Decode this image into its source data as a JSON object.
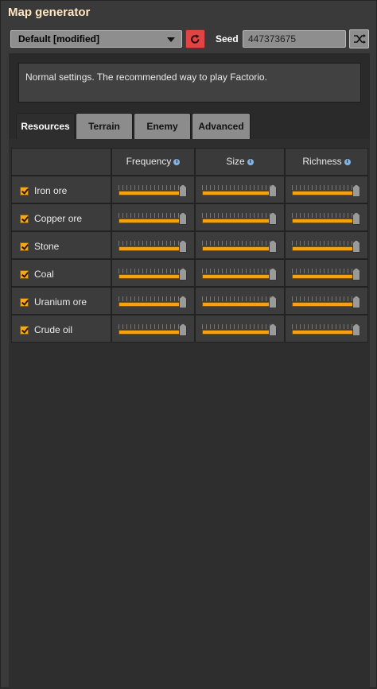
{
  "window": {
    "title": "Map generator"
  },
  "preset": {
    "value": "Default [modified]"
  },
  "seed": {
    "label": "Seed",
    "value": "447373675"
  },
  "description": "Normal settings. The recommended way to play Factorio.",
  "tabs": [
    {
      "label": "Resources",
      "active": true
    },
    {
      "label": "Terrain",
      "active": false
    },
    {
      "label": "Enemy",
      "active": false
    },
    {
      "label": "Advanced",
      "active": false
    }
  ],
  "columns": {
    "frequency": "Frequency",
    "size": "Size",
    "richness": "Richness"
  },
  "resources": [
    {
      "name": "Iron ore",
      "checked": true,
      "frequency": 1.0,
      "size": 1.0,
      "richness": 1.0
    },
    {
      "name": "Copper ore",
      "checked": true,
      "frequency": 1.0,
      "size": 1.0,
      "richness": 1.0
    },
    {
      "name": "Stone",
      "checked": true,
      "frequency": 1.0,
      "size": 1.0,
      "richness": 1.0
    },
    {
      "name": "Coal",
      "checked": true,
      "frequency": 1.0,
      "size": 1.0,
      "richness": 1.0
    },
    {
      "name": "Uranium ore",
      "checked": true,
      "frequency": 1.0,
      "size": 1.0,
      "richness": 1.0
    },
    {
      "name": "Crude oil",
      "checked": true,
      "frequency": 1.0,
      "size": 1.0,
      "richness": 1.0
    }
  ],
  "icons": {
    "dropdown": "chevron-down-icon",
    "reset": "reset-icon",
    "shuffle": "shuffle-icon",
    "info": "info-icon",
    "check": "checkmark-icon"
  },
  "colors": {
    "accent": "#f5a20e",
    "reset_button": "#e04444",
    "title": "#ffe6c0"
  }
}
